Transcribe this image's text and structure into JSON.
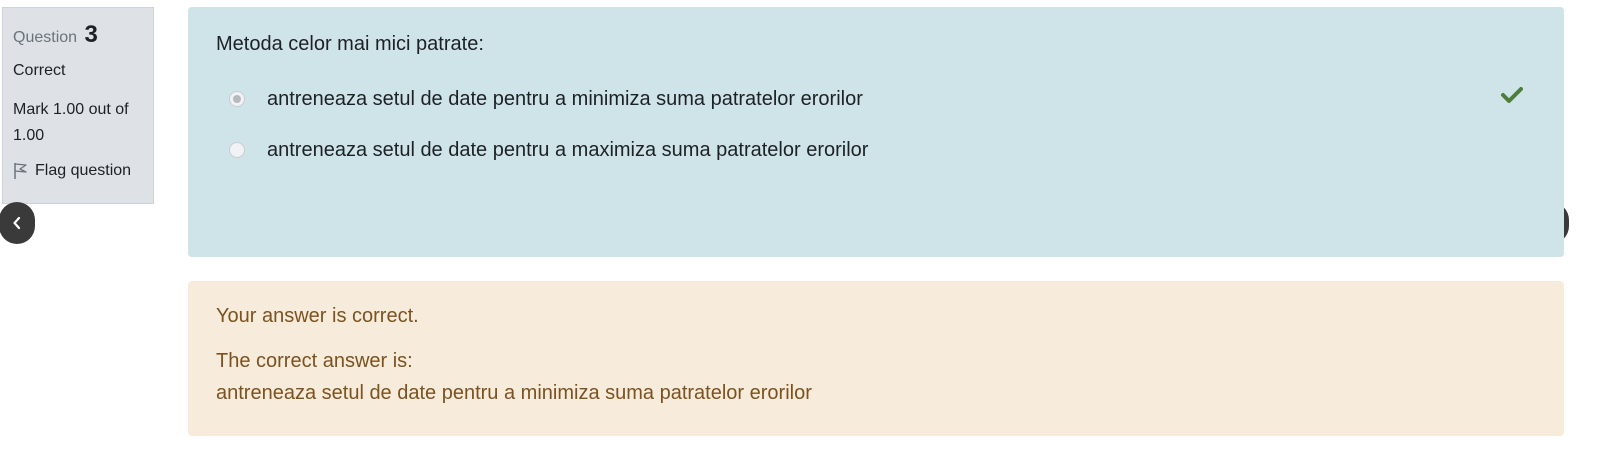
{
  "info": {
    "question_label": "Question",
    "question_number": "3",
    "state": "Correct",
    "grade": "Mark 1.00 out of 1.00",
    "flag_label": "Flag question"
  },
  "question": {
    "text": "Metoda celor mai mici patrate:",
    "options": [
      {
        "label": "antreneaza setul de date pentru a minimiza suma patratelor erorilor",
        "selected": true,
        "correct": true
      },
      {
        "label": "antreneaza setul de date pentru a maximiza suma patratelor erorilor",
        "selected": false,
        "correct": false
      }
    ]
  },
  "outcome": {
    "feedback": "Your answer is correct.",
    "right_answer_intro": "The correct answer is:",
    "right_answer": "antreneaza setul de date pentru a minimiza suma patratelor erorilor"
  },
  "colors": {
    "formulation_bg": "#cfe4e9",
    "outcome_bg": "#f7ecdb",
    "outcome_text": "#7b5220",
    "correct_check": "#4d7e3a"
  },
  "icons": {
    "flag": "flag-icon",
    "prev": "chevron-left-icon",
    "next": "chevron-right-icon",
    "correct": "check-icon"
  }
}
